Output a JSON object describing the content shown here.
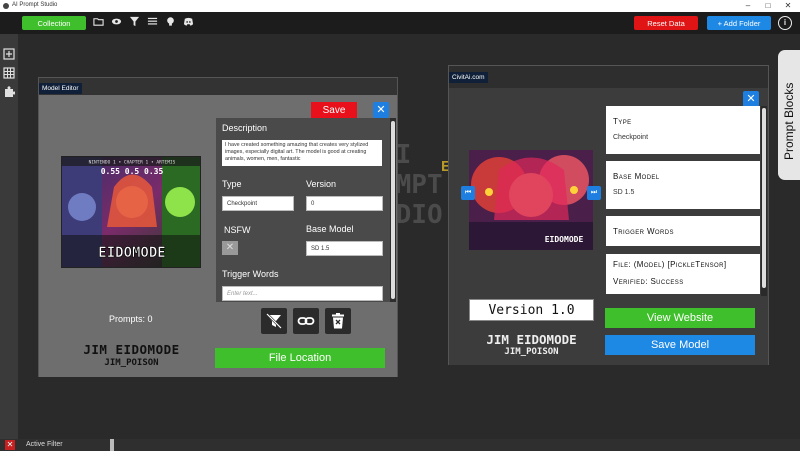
{
  "window": {
    "title": "AI Prompt Studio"
  },
  "toolbar": {
    "collection_label": "Collection",
    "reset_label": "Reset Data",
    "add_folder_label": "+ Add Folder",
    "info_label": "i"
  },
  "background": {
    "logo_lines": [
      "AI",
      "OMPT",
      "UDIO"
    ],
    "logo_e": "E"
  },
  "editor": {
    "tab": "Model Editor",
    "save_label": "Save",
    "close_label": "✕",
    "prompts_count": "Prompts: 0",
    "model_name": "JIM EIDOMODE",
    "author": "JIM_POISON",
    "image_text": "EIDOMODE",
    "image_header": "NINTENDO 1 • CHAPTER 1 • ARTEMIS",
    "image_scores": "0.55  0.5  0.35",
    "form": {
      "description_label": "Description",
      "description_value": "I have created something amazing that creates very stylized images, especially digital art. The model is good at creating animals, women, men, fantastic",
      "type_label": "Type",
      "type_value": "Checkpoint",
      "version_label": "Version",
      "version_value": "0",
      "nsfw_label": "NSFW",
      "nsfw_mark": "✕",
      "base_model_label": "Base Model",
      "base_model_value": "SD 1.5",
      "trigger_label": "Trigger Words",
      "trigger_placeholder": "Enter text..."
    },
    "file_location_label": "File Location"
  },
  "civit": {
    "tab": "CivitAi.com",
    "close_label": "✕",
    "prev_label": "⏮",
    "next_label": "⏭",
    "image_text": "EIDOMODE",
    "version": "Version 1.0",
    "model_name": "JIM EIDOMODE",
    "author": "JIM_POISON",
    "type_label": "Type",
    "type_value": "Checkpoint",
    "base_model_label": "Base Model",
    "base_model_value": "SD 1.5",
    "trigger_label": "Trigger Words",
    "file_label": "File: (Model) [PickleTensor]",
    "verified_label": "Verified: Success",
    "view_website_label": "View Website",
    "save_model_label": "Save Model"
  },
  "prompt_blocks_label": "Prompt Blocks",
  "statusbar": {
    "close_mark": "✕",
    "label": "Active Filter"
  }
}
